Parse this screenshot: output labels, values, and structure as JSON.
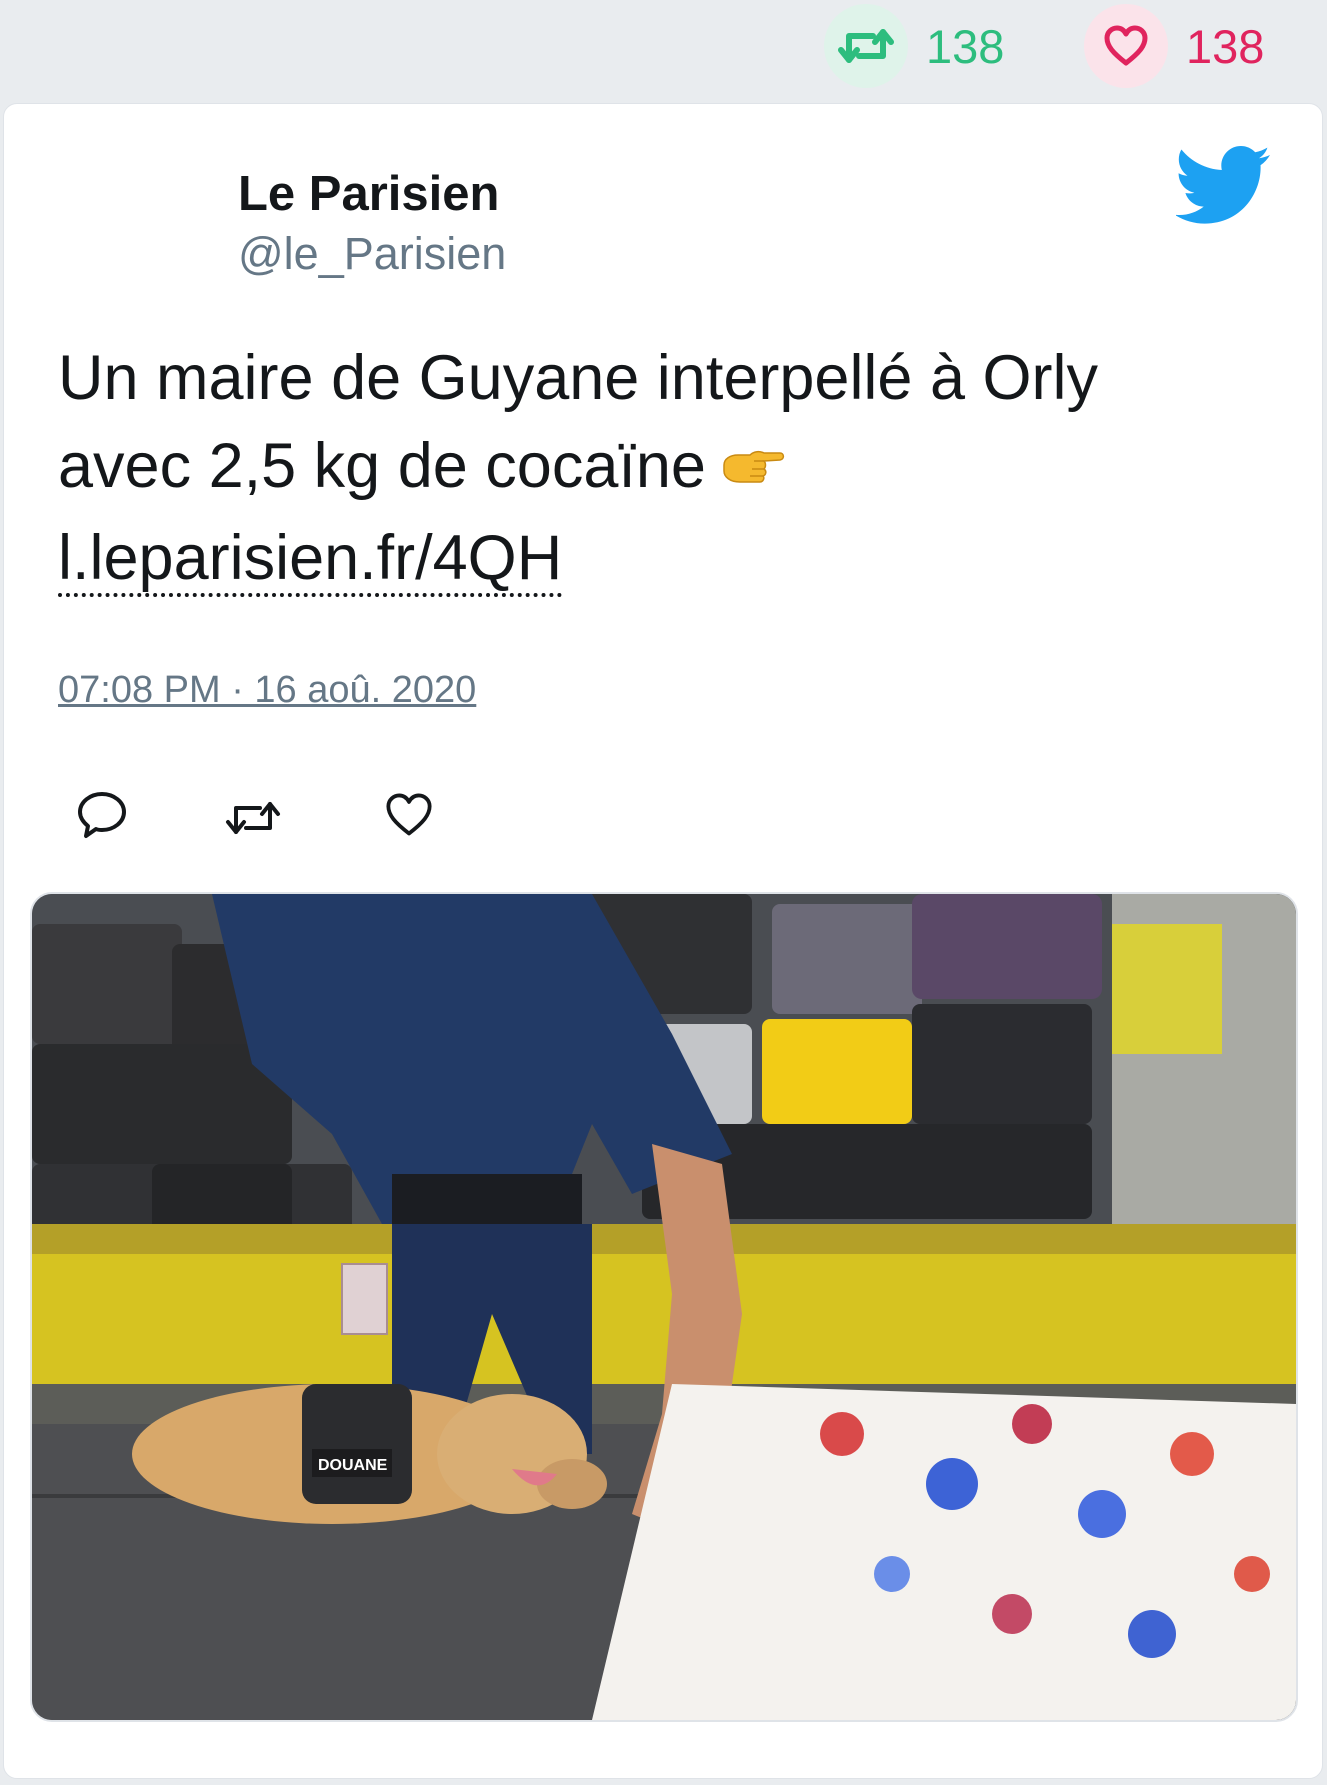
{
  "stats": {
    "retweets": {
      "icon": "retweet-icon",
      "count": "138",
      "color": "#2dbd7e"
    },
    "likes": {
      "icon": "heart-icon",
      "count": "138",
      "color": "#e0245e"
    }
  },
  "tweet": {
    "author_name": "Le Parisien",
    "author_handle": "@le_Parisien",
    "brand_icon": "twitter-bird-icon",
    "brand_color": "#1da1f2",
    "text": "Un maire de Guyane interpellé à Orly avec 2,5 kg de cocaïne",
    "emoji": "pointing-right-hand-emoji",
    "link": "l.leparisien.fr/4QH",
    "timestamp": "07:08 PM · 16 aoû. 2020",
    "actions": [
      "reply-icon",
      "retweet-icon",
      "like-icon"
    ],
    "photo": {
      "badge_text": "DOUANE",
      "icon": "photo-customs-dog-icon"
    }
  }
}
